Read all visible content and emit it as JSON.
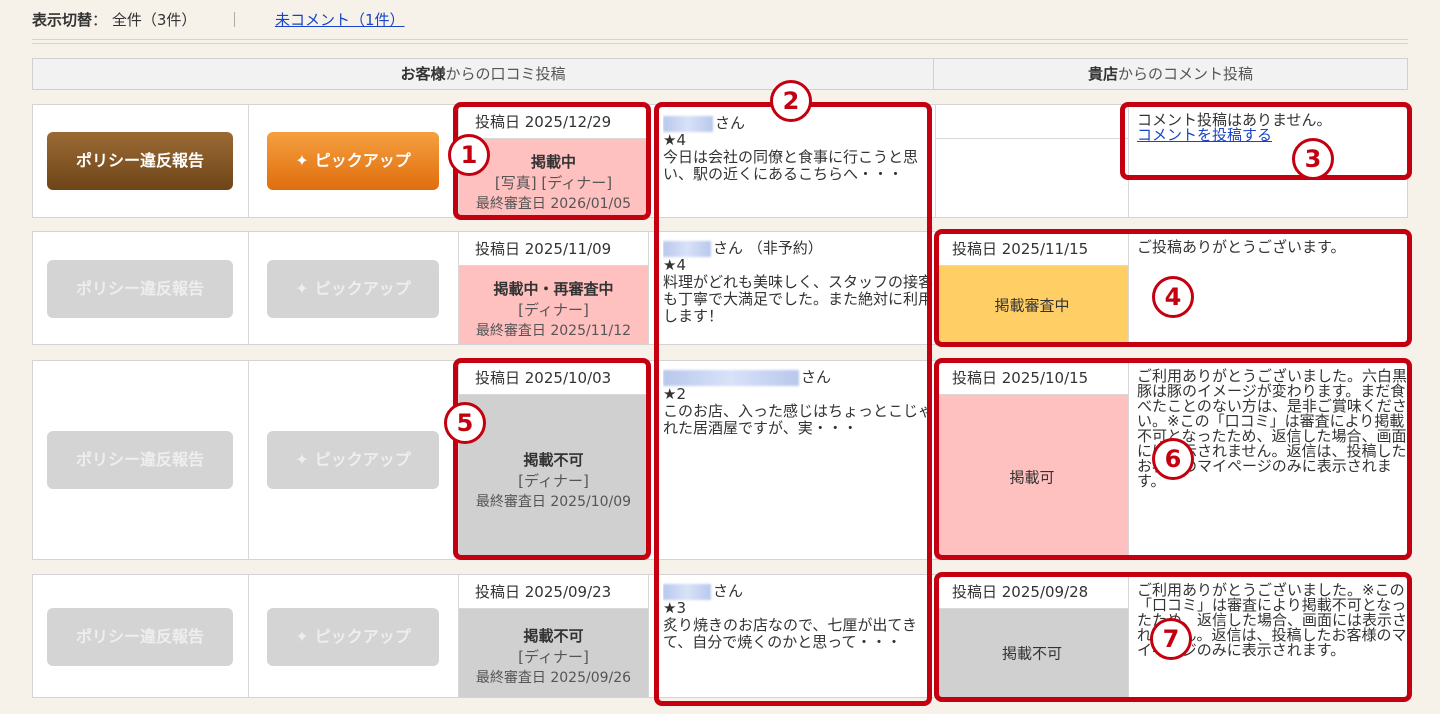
{
  "filter": {
    "label": "表示切替",
    "colon": "：",
    "all": "全件（3件）",
    "sep": "｜",
    "uncommented": "未コメント（1件）"
  },
  "header": {
    "customer_bold": "お客様",
    "customer_rest": "からの口コミ投稿",
    "shop_bold": "貴店",
    "shop_rest": "からのコメント投稿"
  },
  "buttons": {
    "policy": "ポリシー違反報告",
    "pickup": "ピックアップ"
  },
  "rows": [
    {
      "post_date": "投稿日 2025/12/29",
      "status": "掲載中",
      "tags": "[写真] [ディナー]",
      "reviewed": "最終審査日 2026/01/05",
      "name_suffix": "さん",
      "stars": "★4",
      "text": "今日は会社の同僚と食事に行こうと思い、駅の近くにあるこちらへ・・・",
      "shop_date": "",
      "shop_status": "",
      "comment": "コメント投稿はありません。",
      "comment_link": "コメントを投稿する"
    },
    {
      "post_date": "投稿日 2025/11/09",
      "status": "掲載中・再審査中",
      "tags": "[ディナー]",
      "reviewed": "最終審査日 2025/11/12",
      "name_suffix": "さん （非予約）",
      "stars": "★4",
      "text": "料理がどれも美味しく、スタッフの接客も丁寧で大満足でした。また絶対に利用します！",
      "shop_date": "投稿日 2025/11/15",
      "shop_status": "掲載審査中",
      "comment": "ご投稿ありがとうございます。"
    },
    {
      "post_date": "投稿日 2025/10/03",
      "status": "掲載不可",
      "tags": "[ディナー]",
      "reviewed": "最終審査日 2025/10/09",
      "name_suffix": "さん",
      "stars": "★2",
      "text": "このお店、入った感じはちょっとこじゃれた居酒屋ですが、実・・・",
      "shop_date": "投稿日 2025/10/15",
      "shop_status": "掲載可",
      "comment": "ご利用ありがとうございました。六白黒豚は豚のイメージが変わります。まだ食べたことのない方は、是非ご賞味ください。※この「口コミ」は審査により掲載不可となったため、返信した場合、画面には表示されません。返信は、投稿したお客様のマイページのみに表示されます。"
    },
    {
      "post_date": "投稿日 2025/09/23",
      "status": "掲載不可",
      "tags": "[ディナー]",
      "reviewed": "最終審査日 2025/09/26",
      "name_suffix": "さん",
      "stars": "★3",
      "text": "炙り焼きのお店なので、七厘が出てきて、自分で焼くのかと思って・・・",
      "shop_date": "投稿日 2025/09/28",
      "shop_status": "掲載不可",
      "comment": "ご利用ありがとうございました。※この「口コミ」は審査により掲載不可となったため、返信した場合、画面には表示されません。返信は、投稿したお客様のマイページのみに表示されます。"
    }
  ],
  "callouts": [
    "1",
    "2",
    "3",
    "4",
    "5",
    "6",
    "7"
  ],
  "colors": {
    "highlight": "#c40010",
    "pink": "#ffc0c0",
    "yellow": "#ffcf66",
    "gray": "#d0d0d0"
  }
}
